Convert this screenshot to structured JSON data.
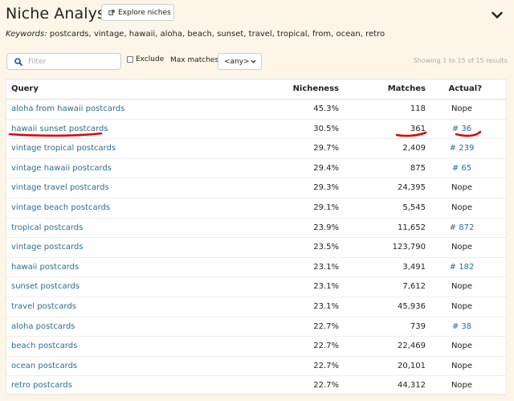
{
  "header": {
    "title": "Niche Analysis",
    "explore_label": "Explore niches"
  },
  "keywords": {
    "label": "Keywords:",
    "value": " postcards, vintage, hawaii, aloha, beach, sunset, travel, tropical, from, ocean, retro"
  },
  "filter": {
    "placeholder": "Filter",
    "exclude_label": "Exclude",
    "max_matches_label": "Max matches",
    "max_matches_value": "<any>",
    "showing": "Showing 1 to 15 of 15 results"
  },
  "table": {
    "headers": {
      "query": "Query",
      "nicheness": "Nicheness",
      "matches": "Matches",
      "actual": "Actual?"
    },
    "rows": [
      {
        "query": "aloha from hawaii postcards",
        "nicheness": "45.3%",
        "matches": "118",
        "actual": "Nope"
      },
      {
        "query": "hawaii sunset postcards",
        "nicheness": "30.5%",
        "matches": "361",
        "actual": "# 36"
      },
      {
        "query": "vintage tropical postcards",
        "nicheness": "29.7%",
        "matches": "2,409",
        "actual": "# 239"
      },
      {
        "query": "vintage hawaii postcards",
        "nicheness": "29.4%",
        "matches": "875",
        "actual": "# 65"
      },
      {
        "query": "vintage travel postcards",
        "nicheness": "29.3%",
        "matches": "24,395",
        "actual": "Nope"
      },
      {
        "query": "vintage beach postcards",
        "nicheness": "29.1%",
        "matches": "5,545",
        "actual": "Nope"
      },
      {
        "query": "tropical postcards",
        "nicheness": "23.9%",
        "matches": "11,652",
        "actual": "# 872"
      },
      {
        "query": "vintage postcards",
        "nicheness": "23.5%",
        "matches": "123,790",
        "actual": "Nope"
      },
      {
        "query": "hawaii postcards",
        "nicheness": "23.1%",
        "matches": "3,491",
        "actual": "# 182"
      },
      {
        "query": "sunset postcards",
        "nicheness": "23.1%",
        "matches": "7,612",
        "actual": "Nope"
      },
      {
        "query": "travel postcards",
        "nicheness": "23.1%",
        "matches": "45,936",
        "actual": "Nope"
      },
      {
        "query": "aloha postcards",
        "nicheness": "22.7%",
        "matches": "739",
        "actual": "# 38"
      },
      {
        "query": "beach postcards",
        "nicheness": "22.7%",
        "matches": "22,469",
        "actual": "Nope"
      },
      {
        "query": "ocean postcards",
        "nicheness": "22.7%",
        "matches": "20,101",
        "actual": "Nope"
      },
      {
        "query": "retro postcards",
        "nicheness": "22.7%",
        "matches": "44,312",
        "actual": "Nope"
      }
    ]
  },
  "colors": {
    "background": "#fdf6e8",
    "link": "#2c6e8f",
    "annotation": "#e00000"
  }
}
